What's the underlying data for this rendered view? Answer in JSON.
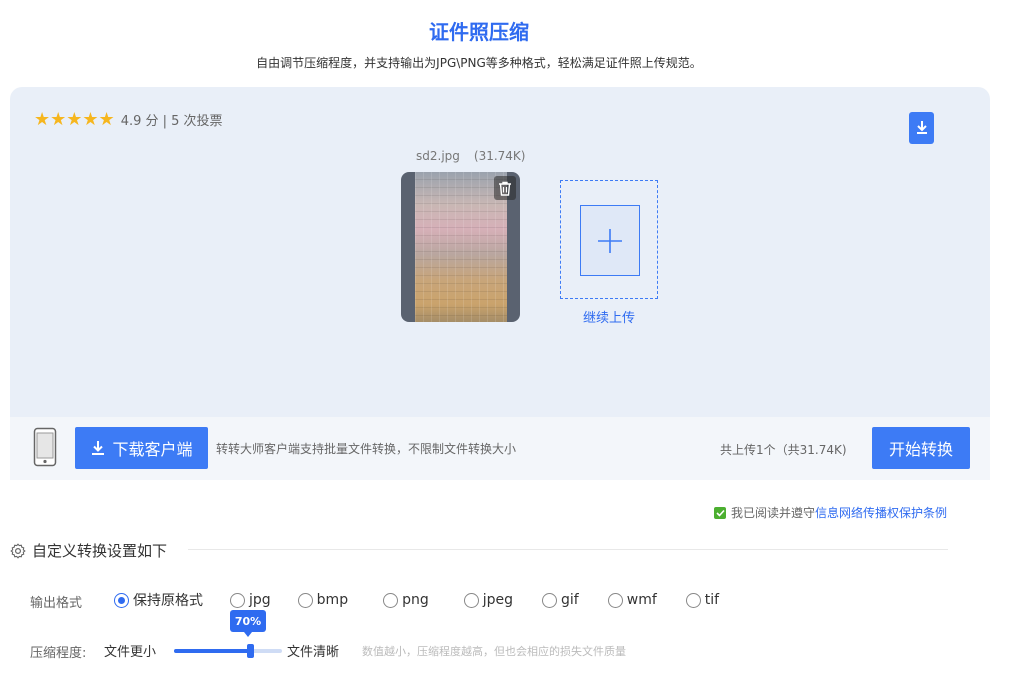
{
  "header": {
    "title": "证件照压缩",
    "subtitle": "自由调节压缩程度，并支持输出为JPG\\PNG等多种格式，轻松满足证件照上传规范。"
  },
  "rating": {
    "stars": "★★★★★",
    "text": "4.9 分 | 5 次投票"
  },
  "file": {
    "name": "sd2.jpg",
    "size": "(31.74K)"
  },
  "upload": {
    "continue_label": "继续上传"
  },
  "bottom_bar": {
    "download_client_label": "下载客户端",
    "description": "转转大师客户端支持批量文件转换，不限制文件转换大小",
    "upload_count": "共上传1个（共31.74K)",
    "start_label": "开始转换"
  },
  "agreement": {
    "prefix": "我已阅读并遵守",
    "link": "信息网络传播权保护条例",
    "checked": true
  },
  "settings": {
    "section_title": "自定义转换设置如下",
    "format_label": "输出格式",
    "formats": [
      "保持原格式",
      "jpg",
      "bmp",
      "png",
      "jpeg",
      "gif",
      "wmf",
      "tif"
    ],
    "selected_format": "保持原格式",
    "compress_label": "压缩程度:",
    "smaller_label": "文件更小",
    "clearer_label": "文件清晰",
    "compress_value": "70%",
    "compress_fraction": 0.7,
    "hint": "数值越小，压缩程度越高，但也会相应的损失文件质量"
  },
  "colors": {
    "accent": "#3d7bf5",
    "star": "#f6b61e",
    "check": "#4caf30"
  }
}
